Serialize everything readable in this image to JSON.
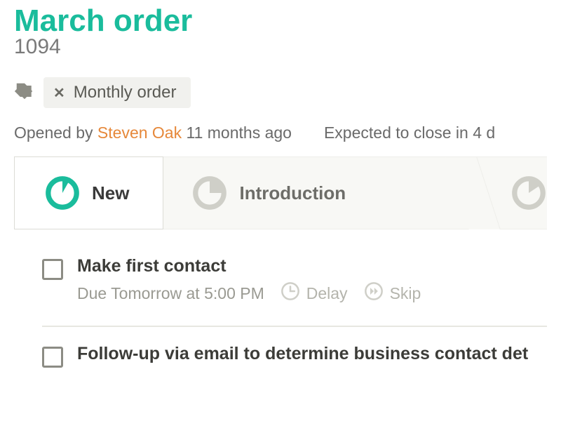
{
  "title": "March order",
  "record_number": "1094",
  "tag": {
    "label": "Monthly order"
  },
  "meta": {
    "opened_prefix": "Opened by ",
    "author": "Steven Oak",
    "opened_suffix": " 11 months ago",
    "expected": "Expected to close in 4 d"
  },
  "stages": {
    "active": "New",
    "next": "Introduction"
  },
  "tasks": [
    {
      "title": "Make first contact",
      "due": "Due Tomorrow at 5:00 PM",
      "actions": {
        "delay": "Delay",
        "skip": "Skip"
      }
    },
    {
      "title": "Follow-up via email to determine business contact det"
    }
  ]
}
